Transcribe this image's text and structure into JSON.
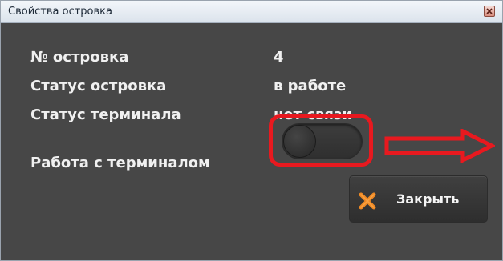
{
  "window": {
    "title": "Свойства островка"
  },
  "properties": [
    {
      "label": "№ островка",
      "value": "4"
    },
    {
      "label": "Статус островка",
      "value": "в работе"
    },
    {
      "label": "Статус терминала",
      "value": "нет связи"
    }
  ],
  "terminal_toggle": {
    "label": "Работа с терминалом",
    "state": "off"
  },
  "close_button": {
    "label": "Закрыть",
    "icon": "orange-x-icon"
  },
  "colors": {
    "panel_background": "#474747",
    "highlight": "#e8191f",
    "close_icon": "#f08a24",
    "text": "#f0f0f0"
  }
}
